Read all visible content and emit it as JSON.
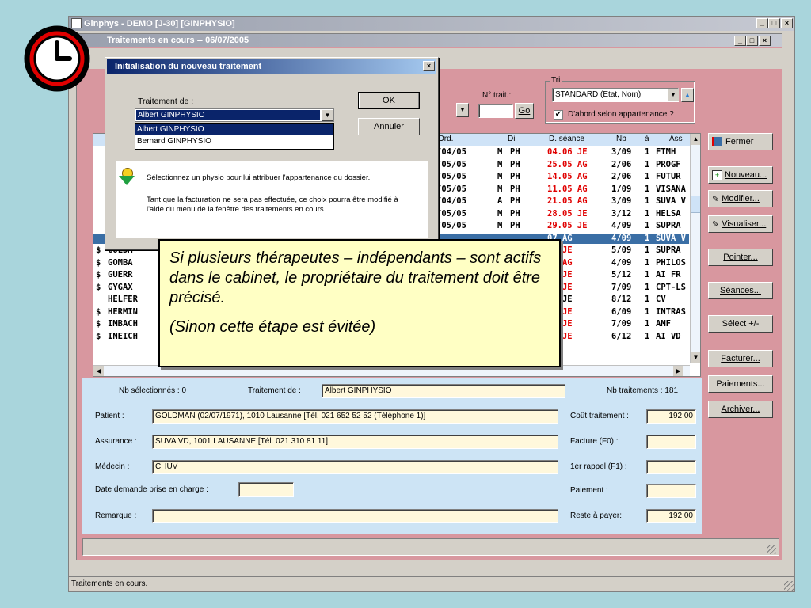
{
  "app": {
    "title": "Ginphys - DEMO [J-30] [GINPHYSIO]",
    "inner_title": "Traitements en cours  --  06/07/2005",
    "status_bar": "Traitements en cours."
  },
  "colors": {
    "accent_pink": "#d8979f",
    "panel_blue": "#cde4f5",
    "title_blue": "#0a246a",
    "selection_blue": "#3a6ea5",
    "red_text": "#e00000"
  },
  "filter": {
    "n_trait_label": "N° trait.:",
    "go_label": "Go",
    "tri_label": "Tri",
    "tri_value": "STANDARD (Etat, Nom)",
    "belonging_checkbox": "D'abord selon appartenance ?"
  },
  "table": {
    "headers": [
      "Ord.",
      "Di",
      "D. séance",
      "Nb",
      "à",
      "Ass"
    ],
    "rows": [
      {
        "ord": "/04/05",
        "di1": "M",
        "di2": "PH",
        "date": "04.06 JE",
        "nb": "3/09",
        "a": "1",
        "ass": "FTMH",
        "red": true
      },
      {
        "ord": "/05/05",
        "di1": "M",
        "di2": "PH",
        "date": "25.05 AG",
        "nb": "2/06",
        "a": "1",
        "ass": "PROGF",
        "red": true
      },
      {
        "ord": "/05/05",
        "di1": "M",
        "di2": "PH",
        "date": "14.05 AG",
        "nb": "2/06",
        "a": "1",
        "ass": "FUTUR",
        "red": true
      },
      {
        "ord": "/05/05",
        "di1": "M",
        "di2": "PH",
        "date": "11.05 AG",
        "nb": "1/09",
        "a": "1",
        "ass": "VISANA",
        "red": true
      },
      {
        "ord": "/04/05",
        "di1": "A",
        "di2": "PH",
        "date": "21.05 AG",
        "nb": "3/09",
        "a": "1",
        "ass": "SUVA V",
        "red": true
      },
      {
        "ord": "/05/05",
        "di1": "M",
        "di2": "PH",
        "date": "28.05 JE",
        "nb": "3/12",
        "a": "1",
        "ass": "HELSA",
        "red": true
      },
      {
        "ord": "/05/05",
        "di1": "M",
        "di2": "PH",
        "date": "29.05 JE",
        "nb": "4/09",
        "a": "1",
        "ass": "SUPRA",
        "red": true
      },
      {
        "date": "07 AG",
        "nb": "4/09",
        "a": "1",
        "ass": "SUVA V",
        "selected": true
      },
      {
        "dollar": "$",
        "name": "GOLDM",
        "date": "06 JE",
        "nb": "5/09",
        "a": "1",
        "ass": "SUPRA",
        "red": true
      },
      {
        "dollar": "$",
        "name": "GOMBA",
        "date": "06 AG",
        "nb": "4/09",
        "a": "1",
        "ass": "PHILOS",
        "red": true
      },
      {
        "dollar": "$",
        "name": "GUERR",
        "date": "05 JE",
        "nb": "5/12",
        "a": "1",
        "ass": "AI FR",
        "red": true
      },
      {
        "dollar": "$",
        "name": "GYGAX",
        "date": "06 JE",
        "nb": "7/09",
        "a": "1",
        "ass": "CPT-LS",
        "red": true
      },
      {
        "dollar": "",
        "name": "HELFER",
        "date": "06 JE",
        "nb": "8/12",
        "a": "1",
        "ass": "CV",
        "red": false
      },
      {
        "dollar": "$",
        "name": "HERMIN",
        "date": "06 JE",
        "nb": "6/09",
        "a": "1",
        "ass": "INTRAS",
        "red": true
      },
      {
        "dollar": "$",
        "name": "IMBACH",
        "date": "06 JE",
        "nb": "7/09",
        "a": "1",
        "ass": "AMF",
        "red": true
      },
      {
        "dollar": "$",
        "name": "INEICH",
        "date": "06 JE",
        "nb": "6/12",
        "a": "1",
        "ass": "AI VD",
        "red": true
      }
    ]
  },
  "side_buttons": {
    "fermer": "Fermer",
    "nouveau": "Nouveau...",
    "modifier": "Modifier...",
    "visualiser": "Visualiser...",
    "pointer": "Pointer...",
    "seances": "Séances...",
    "select": "Sélect +/-",
    "facturer": "Facturer...",
    "paiements": "Paiements...",
    "archiver": "Archiver..."
  },
  "details": {
    "nb_selected_label": "Nb sélectionnés :  0",
    "traitement_label": "Traitement de :",
    "traitement_value": "Albert GINPHYSIO",
    "nb_traitements": "Nb traitements :  181",
    "patient_label": "Patient :",
    "patient_value": "GOLDMAN (02/07/1971), 1010 Lausanne  [Tél. 021 652 52 52 (Téléphone 1)]",
    "assurance_label": "Assurance :",
    "assurance_value": "SUVA VD, 1001 LAUSANNE  [Tél. 021 310 81 11]",
    "medecin_label": "Médecin :",
    "medecin_value": "CHUV",
    "date_demande_label": "Date demande prise en charge :",
    "remarque_label": "Remarque :",
    "cout_label": "Coût traitement :",
    "cout_value": "192,00",
    "facture_label": "Facture (F0) :",
    "rappel_label": "1er rappel (F1) :",
    "paiement_label": "Paiement :",
    "reste_label": "Reste à payer:",
    "reste_value": "192,00"
  },
  "dialog": {
    "title": "Initialisation du nouveau traitement",
    "traitement_de_label": "Traitement de :",
    "combo_value": "Albert GINPHYSIO",
    "options": [
      "Albert GINPHYSIO",
      "Bernard GINPHYSIO"
    ],
    "ok_label": "OK",
    "cancel_label": "Annuler",
    "info_line1": "Sélectionnez un physio pour lui attribuer l'appartenance du dossier.",
    "info_line2": "Tant que la facturation ne sera pas effectuée, ce choix pourra être modifié à l'aide du menu de la fenêtre des traitements en cours."
  },
  "callout": {
    "text1": "Si plusieurs thérapeutes – indépendants – sont actifs dans le cabinet, le propriétaire du traitement doit être précisé.",
    "text2": "(Sinon cette étape est évitée)"
  }
}
